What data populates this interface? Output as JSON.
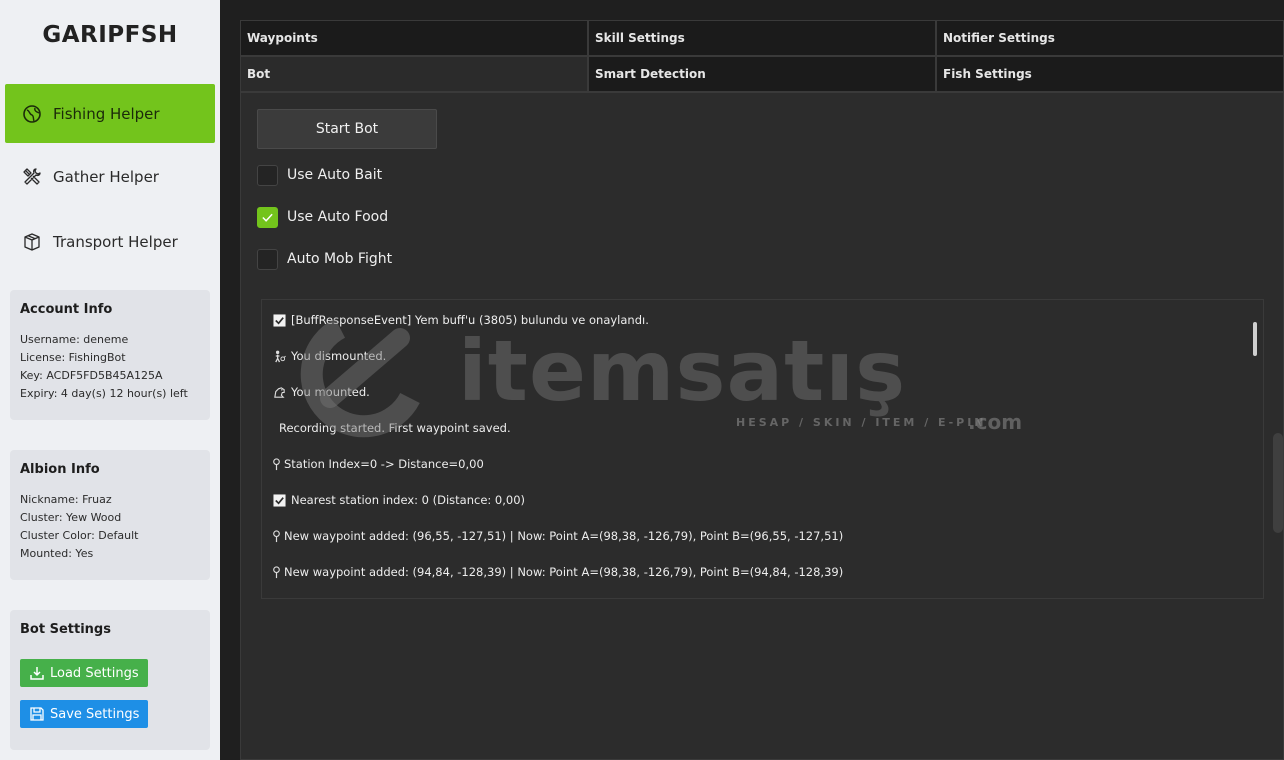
{
  "app": {
    "brand": "GARIPFSH"
  },
  "sidebar": {
    "nav": [
      {
        "label": "Fishing Helper",
        "icon": "globe-icon",
        "active": true
      },
      {
        "label": "Gather Helper",
        "icon": "tools-icon",
        "active": false
      },
      {
        "label": "Transport Helper",
        "icon": "box-icon",
        "active": false
      }
    ],
    "account": {
      "title": "Account Info",
      "username": "Username: deneme",
      "license": "License: FishingBot",
      "key": "Key: ACDF5FD5B45A125A",
      "expiry": "Expiry: 4 day(s) 12 hour(s) left"
    },
    "albion": {
      "title": "Albion Info",
      "nickname": "Nickname: Fruaz",
      "cluster": "Cluster: Yew Wood",
      "cluster_color": "Cluster Color: Default",
      "mounted": "Mounted: Yes"
    },
    "bot_settings": {
      "title": "Bot Settings",
      "load_label": "Load Settings",
      "save_label": "Save Settings"
    }
  },
  "tabs": {
    "row1": [
      "Waypoints",
      "Skill Settings",
      "Notifier Settings"
    ],
    "row2": [
      "Bot",
      "Smart Detection",
      "Fish Settings"
    ],
    "active": "Bot"
  },
  "bot": {
    "start_label": "Start Bot",
    "options": [
      {
        "label": "Use Auto Bait",
        "checked": false
      },
      {
        "label": "Use Auto Food",
        "checked": true
      },
      {
        "label": "Auto Mob Fight",
        "checked": false
      }
    ]
  },
  "log": [
    {
      "icon": "checkbox-icon",
      "text": "[BuffResponseEvent] Yem buff'u (3805) bulundu ve onaylandı."
    },
    {
      "icon": "walker-icon",
      "text": "You dismounted."
    },
    {
      "icon": "horse-icon",
      "text": "You mounted."
    },
    {
      "icon": "none",
      "text": "Recording started. First waypoint saved."
    },
    {
      "icon": "pin-icon",
      "text": "Station Index=0 -> Distance=0,00"
    },
    {
      "icon": "checkbox-icon",
      "text": "Nearest station index: 0 (Distance: 0,00)"
    },
    {
      "icon": "pin-icon",
      "text": "New waypoint added: (96,55, -127,51) | Now: Point A=(98,38, -126,79), Point B=(96,55, -127,51)"
    },
    {
      "icon": "pin-icon",
      "text": "New waypoint added: (94,84, -128,39) | Now: Point A=(98,38, -126,79), Point B=(94,84, -128,39)"
    }
  ],
  "watermark": {
    "text": "itemsatış",
    "sub": "HESAP / SKIN / ITEM / E-PIN",
    "com": ".com"
  },
  "colors": {
    "accent": "#73c41c",
    "load": "#46b04a",
    "save": "#1e8fe6"
  }
}
